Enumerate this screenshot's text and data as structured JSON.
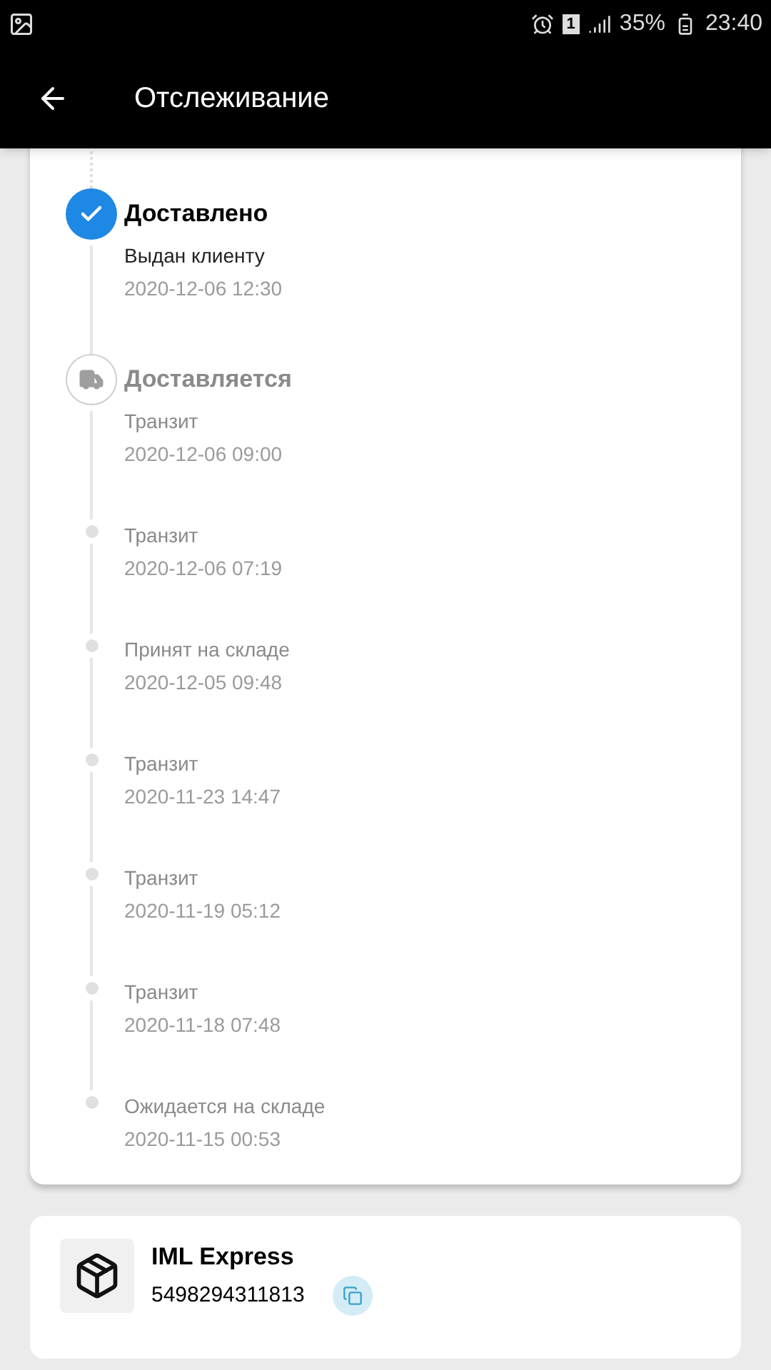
{
  "status_bar": {
    "battery": "35%",
    "time": "23:40",
    "sim": "1"
  },
  "header": {
    "title": "Отслеживание"
  },
  "events": [
    {
      "kind": "delivered",
      "title": "Доставлено",
      "description": "Выдан клиенту",
      "time": "2020-12-06 12:30"
    },
    {
      "kind": "in_transit",
      "title": "Доставляется",
      "description": "Транзит",
      "time": "2020-12-06 09:00"
    },
    {
      "kind": "event",
      "description": "Транзит",
      "time": "2020-12-06 07:19"
    },
    {
      "kind": "event",
      "description": "Принят на складе",
      "time": "2020-12-05 09:48"
    },
    {
      "kind": "event",
      "description": "Транзит",
      "time": "2020-11-23 14:47"
    },
    {
      "kind": "event",
      "description": "Транзит",
      "time": "2020-11-19 05:12"
    },
    {
      "kind": "event",
      "description": "Транзит",
      "time": "2020-11-18 07:48"
    },
    {
      "kind": "event",
      "description": "Ожидается на складе",
      "time": "2020-11-15 00:53"
    }
  ],
  "carrier": {
    "name": "IML Express",
    "tracking_number": "5498294311813"
  }
}
